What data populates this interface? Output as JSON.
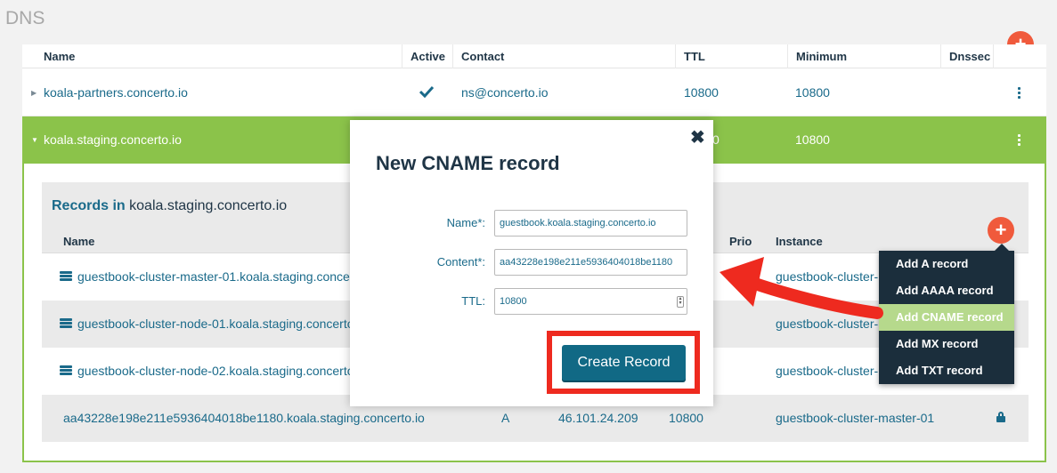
{
  "page": {
    "title": "DNS"
  },
  "zones_table": {
    "headers": [
      "Name",
      "Active",
      "Contact",
      "TTL",
      "Minimum",
      "Dnssec"
    ],
    "rows": [
      {
        "name": "koala-partners.concerto.io",
        "active_icon": "check-icon",
        "contact": "ns@concerto.io",
        "ttl": "10800",
        "minimum": "10800"
      },
      {
        "name": "koala.staging.concerto.io",
        "contact": "",
        "ttl": "0",
        "minimum": "10800"
      }
    ]
  },
  "records": {
    "title_prefix": "Records in",
    "title_zone": "koala.staging.concerto.io",
    "headers": [
      "Name",
      "Prio",
      "Instance"
    ],
    "rows": [
      {
        "name": "guestbook-cluster-master-01.koala.staging.concert",
        "instance": "guestbook-cluster-r"
      },
      {
        "name": "guestbook-cluster-node-01.koala.staging.concerto.",
        "instance": "guestbook-cluster-r"
      },
      {
        "name": "guestbook-cluster-node-02.koala.staging.concerto.",
        "instance": "guestbook-cluster-r"
      },
      {
        "name": "aa43228e198e211e5936404018be1180.koala.staging.concerto.io",
        "type": "A",
        "content": "46.101.24.209",
        "ttl": "10800",
        "instance": "guestbook-cluster-master-01"
      }
    ]
  },
  "add_menu": {
    "items": [
      "Add A record",
      "Add AAAA record",
      "Add CNAME record",
      "Add MX record",
      "Add TXT record"
    ],
    "highlighted_index": 2
  },
  "modal": {
    "title": "New CNAME record",
    "fields": {
      "name_label": "Name*:",
      "name_value": "guestbook.koala.staging.concerto.io",
      "content_label": "Content*:",
      "content_value": "aa43228e198e211e5936404018be1180",
      "ttl_label": "TTL:",
      "ttl_value": "10800"
    },
    "submit_label": "Create Record"
  },
  "colors": {
    "accent_green": "#8bc34a",
    "add_button": "#f05a3c",
    "primary_button": "#116985",
    "annotation_red": "#ee2a1f",
    "menu_bg": "#1b2e3c",
    "menu_highlight": "#b6d98c"
  }
}
